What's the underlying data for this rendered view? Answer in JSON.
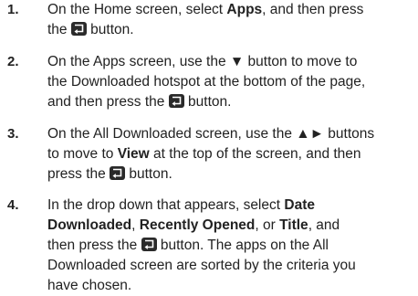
{
  "steps": [
    {
      "number": "1.",
      "lines": [
        [
          "On the Home screen, select ",
          {
            "b": "Apps"
          },
          ", and then press"
        ],
        [
          "the ",
          {
            "icon": "enter-button-icon"
          },
          " button."
        ]
      ]
    },
    {
      "number": "2.",
      "lines": [
        [
          "On the Apps screen, use the ▼ button to move to"
        ],
        [
          "the Downloaded hotspot at the bottom of the page,"
        ],
        [
          "and then press the ",
          {
            "icon": "enter-button-icon"
          },
          " button."
        ]
      ]
    },
    {
      "number": "3.",
      "lines": [
        [
          "On the All Downloaded screen, use the ▲► buttons"
        ],
        [
          "to move to ",
          {
            "b": "View"
          },
          " at the top of the screen, and then"
        ],
        [
          "press the ",
          {
            "icon": "enter-button-icon"
          },
          " button."
        ]
      ]
    },
    {
      "number": "4.",
      "lines": [
        [
          "In the drop down that appears, select ",
          {
            "b": "Date"
          }
        ],
        [
          {
            "b": "Downloaded"
          },
          ", ",
          {
            "b": "Recently Opened"
          },
          ", or ",
          {
            "b": "Title"
          },
          ", and"
        ],
        [
          "then press the ",
          {
            "icon": "enter-button-icon"
          },
          " button. The apps on the All"
        ],
        [
          "Downloaded screen are sorted by the criteria you"
        ],
        [
          "have chosen."
        ]
      ]
    }
  ]
}
